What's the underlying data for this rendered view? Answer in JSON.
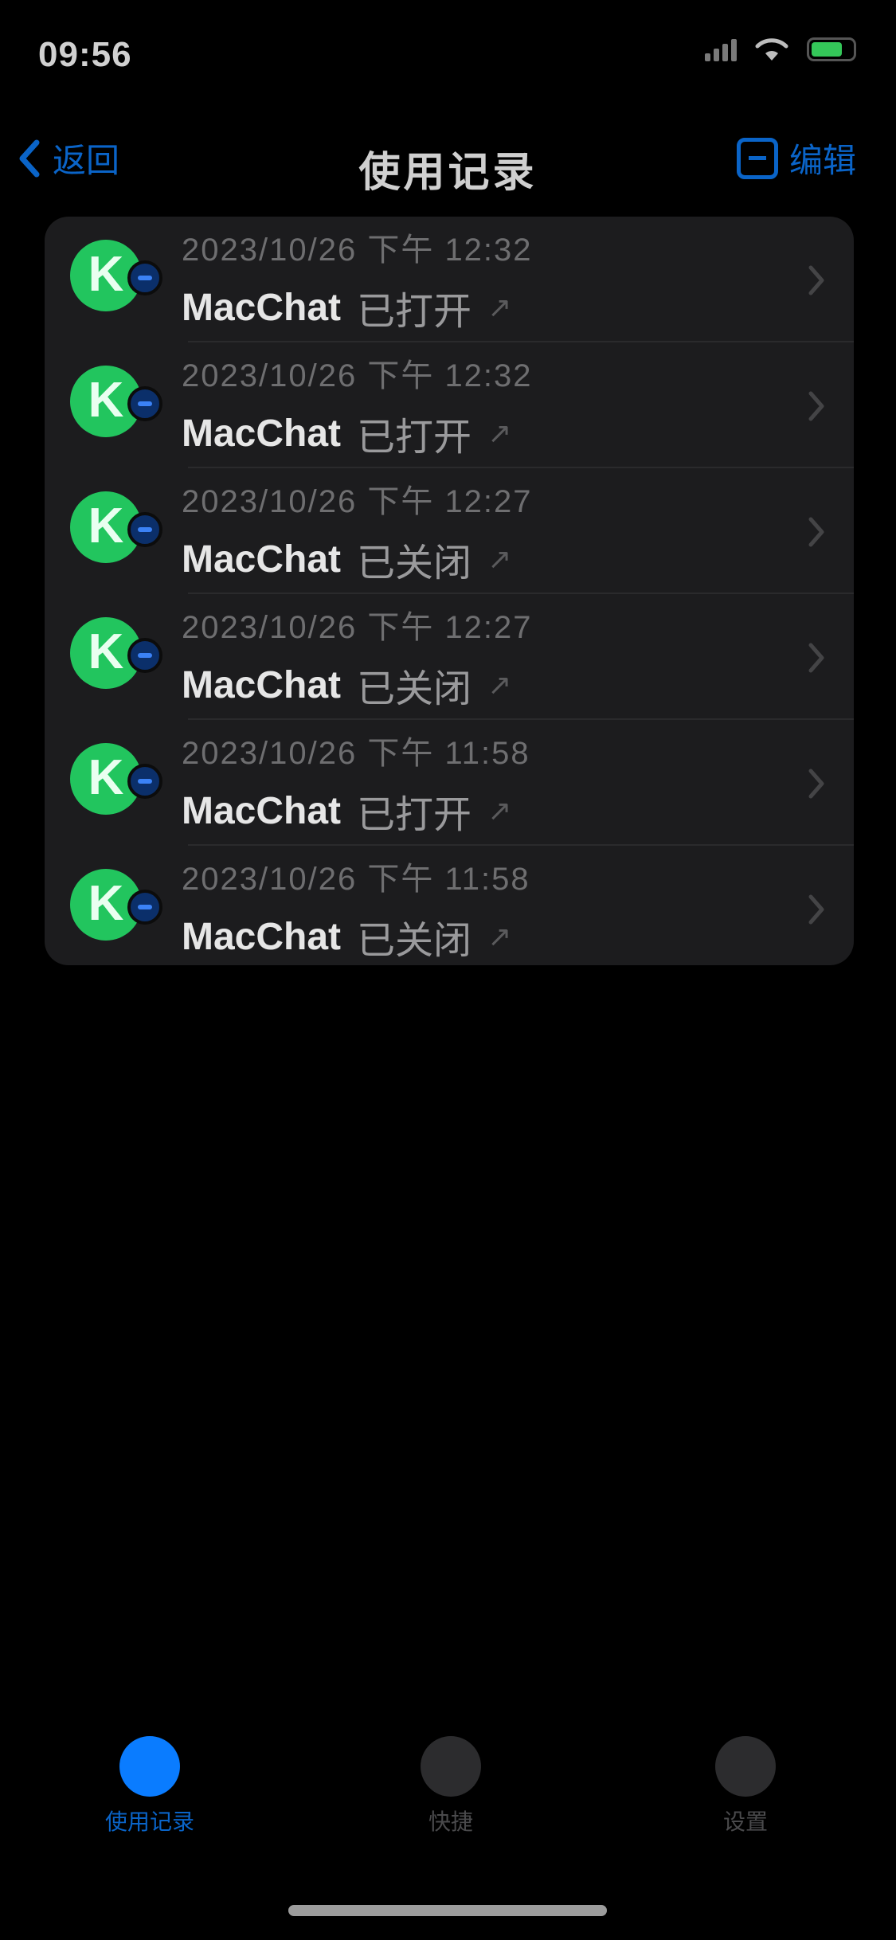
{
  "status_bar": {
    "time": "09:56",
    "signal_icon": "cellular-signal-icon",
    "wifi_icon": "wifi-icon",
    "battery_icon": "battery-icon",
    "battery_level": 0.75,
    "battery_color": "#34c759"
  },
  "nav": {
    "back_label": "返回",
    "back_icon": "chevron-left-icon",
    "title": "使用记录",
    "edit_label": "编辑",
    "edit_icon": "edit-icon",
    "accent_color": "#0a64c8"
  },
  "records": [
    {
      "date": "2023/10/26",
      "time": "下午 12:32",
      "name": "MacChat",
      "status": "已打开",
      "app_icon": "k-app-icon",
      "chevron": "chevron-right-icon"
    },
    {
      "date": "2023/10/26",
      "time": "下午 12:32",
      "name": "MacChat",
      "status": "已打开",
      "app_icon": "k-app-icon",
      "chevron": "chevron-right-icon"
    },
    {
      "date": "2023/10/26",
      "time": "下午 12:27",
      "name": "MacChat",
      "status": "已关闭",
      "app_icon": "k-app-icon",
      "chevron": "chevron-right-icon"
    },
    {
      "date": "2023/10/26",
      "time": "下午 12:27",
      "name": "MacChat",
      "status": "已关闭",
      "app_icon": "k-app-icon",
      "chevron": "chevron-right-icon"
    },
    {
      "date": "2023/10/26",
      "time": "下午 11:58",
      "name": "MacChat",
      "status": "已打开",
      "app_icon": "k-app-icon",
      "chevron": "chevron-right-icon"
    },
    {
      "date": "2023/10/26",
      "time": "下午 11:58",
      "name": "MacChat",
      "status": "已关闭",
      "app_icon": "k-app-icon",
      "chevron": "chevron-right-icon"
    }
  ],
  "tab_bar": {
    "tabs": [
      {
        "label": "使用记录",
        "icon": "history-tab-icon",
        "active": true
      },
      {
        "label": "快捷",
        "icon": "shortcuts-tab-icon",
        "active": false
      },
      {
        "label": "设置",
        "icon": "settings-tab-icon",
        "active": false
      }
    ],
    "active_color": "#0a7cff"
  }
}
